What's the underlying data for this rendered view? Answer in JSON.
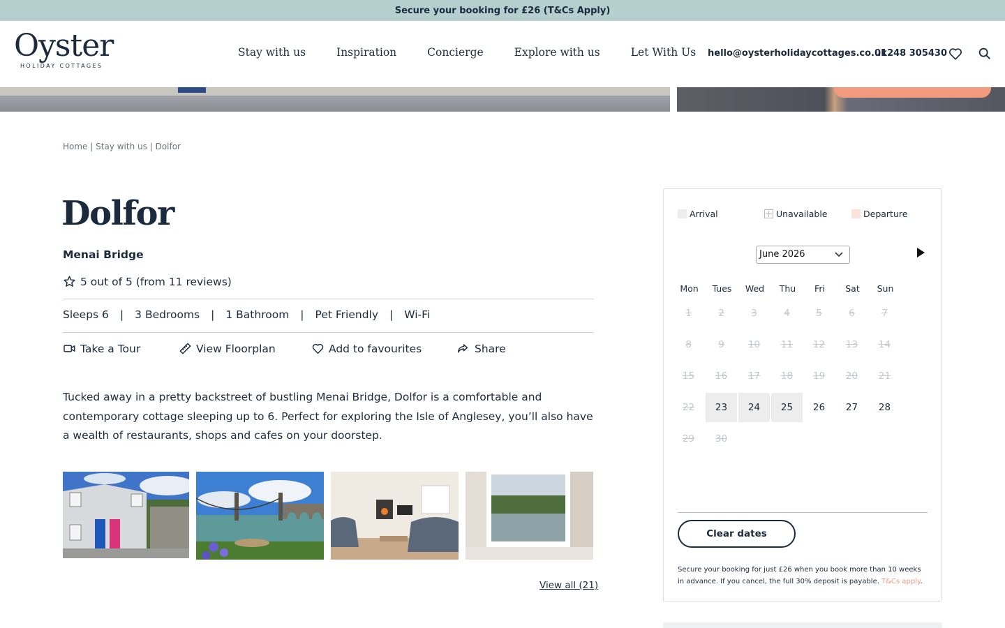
{
  "promo": {
    "text": "Secure your booking for £26 (T&Cs Apply)"
  },
  "header": {
    "logo_word": "Oyster",
    "logo_sub": "HOLIDAY COTTAGES",
    "nav": [
      "Stay with us",
      "Inspiration",
      "Concierge",
      "Explore with us",
      "Let With Us"
    ],
    "email": "hello@oysterholidaycottages.co.uk",
    "phone": "01248 305430",
    "icons": [
      "heart-icon",
      "search-icon"
    ]
  },
  "breadcrumb": {
    "home": "Home",
    "sep": "|",
    "stay": "Stay with us",
    "current": "Dolfor"
  },
  "property": {
    "title": "Dolfor",
    "location": "Menai Bridge",
    "rating": "5 out of 5 (from 11 reviews)",
    "features": [
      "Sleeps 6",
      "3 Bedrooms",
      "1 Bathroom",
      "Pet Friendly",
      "Wi-Fi"
    ],
    "feature_sep": "|",
    "actions": {
      "tour": "Take a Tour",
      "floorplan": "View Floorplan",
      "favourites": "Add to favourites",
      "share": "Share"
    },
    "description": "Tucked away in a pretty backstreet of bustling Menai Bridge, Dolfor is a comfortable and contemporary cottage sleeping up to 6. Perfect for exploring the Isle of Anglesey, you’ll also have a wealth of restaurants, shops and cafes on your doorstep.",
    "view_all": "View all (21)"
  },
  "booking": {
    "legend": {
      "arrival": "Arrival",
      "unavailable": "Unavailable",
      "departure": "Departure"
    },
    "month": "June 2026",
    "weekdays": [
      "Mon",
      "Tues",
      "Wed",
      "Thu",
      "Fri",
      "Sat",
      "Sun"
    ],
    "days": [
      {
        "d": "1",
        "s": "past"
      },
      {
        "d": "2",
        "s": "past"
      },
      {
        "d": "3",
        "s": "past"
      },
      {
        "d": "4",
        "s": "past"
      },
      {
        "d": "5",
        "s": "past"
      },
      {
        "d": "6",
        "s": "past"
      },
      {
        "d": "7",
        "s": "past"
      },
      {
        "d": "8",
        "s": "past"
      },
      {
        "d": "9",
        "s": "past"
      },
      {
        "d": "10",
        "s": "past"
      },
      {
        "d": "11",
        "s": "past"
      },
      {
        "d": "12",
        "s": "past"
      },
      {
        "d": "13",
        "s": "past"
      },
      {
        "d": "14",
        "s": "past"
      },
      {
        "d": "15",
        "s": "past"
      },
      {
        "d": "16",
        "s": "past"
      },
      {
        "d": "17",
        "s": "past"
      },
      {
        "d": "18",
        "s": "past"
      },
      {
        "d": "19",
        "s": "past"
      },
      {
        "d": "20",
        "s": "past"
      },
      {
        "d": "21",
        "s": "past"
      },
      {
        "d": "22",
        "s": "past"
      },
      {
        "d": "23",
        "s": "arrival"
      },
      {
        "d": "24",
        "s": "arrival"
      },
      {
        "d": "25",
        "s": "arrival"
      },
      {
        "d": "26",
        "s": "available"
      },
      {
        "d": "27",
        "s": "available"
      },
      {
        "d": "28",
        "s": "available"
      },
      {
        "d": "29",
        "s": "past"
      },
      {
        "d": "30",
        "s": "past"
      }
    ],
    "clear": "Clear dates",
    "note": "Secure your booking for just £26 when you book more than 10 weeks in advance. If you cancel, the full 30% deposit is payable.",
    "note_link": "T&Cs apply",
    "note_end": "."
  },
  "colors": {
    "navy": "#1b2a3d",
    "banner": "#b5cece",
    "accent": "#f29a7d",
    "arrival": "#ededed"
  }
}
